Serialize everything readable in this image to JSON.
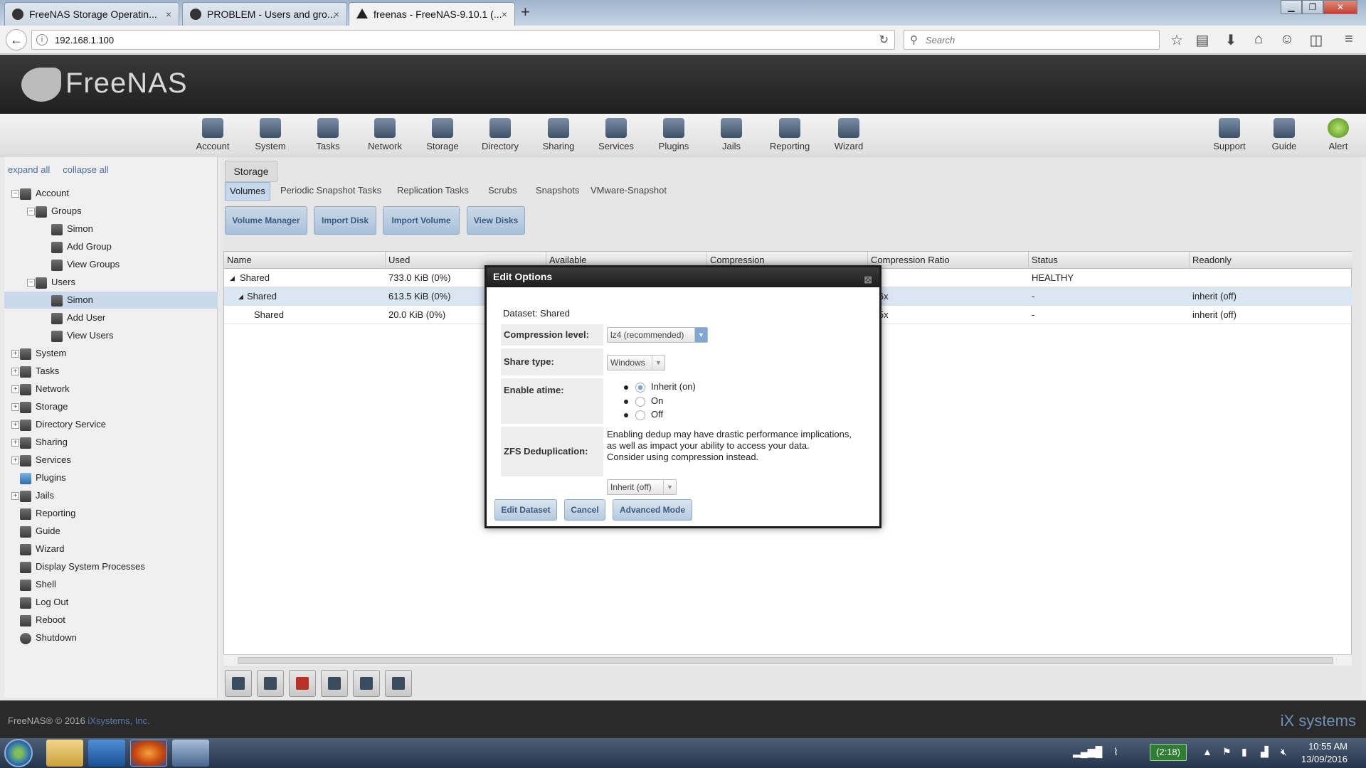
{
  "browser": {
    "tabs": [
      {
        "label": "FreeNAS Storage Operatin...",
        "close": "×"
      },
      {
        "label": "PROBLEM - Users and gro...",
        "close": "×"
      },
      {
        "label": "freenas - FreeNAS-9.10.1 (...",
        "close": "×"
      }
    ],
    "new_tab": "+",
    "url": "192.168.1.100",
    "search_placeholder": "Search"
  },
  "app": {
    "logo": "FreeNAS",
    "menu": [
      "Account",
      "System",
      "Tasks",
      "Network",
      "Storage",
      "Directory",
      "Sharing",
      "Services",
      "Plugins",
      "Jails",
      "Reporting",
      "Wizard"
    ],
    "menu_right": [
      "Support",
      "Guide",
      "Alert"
    ]
  },
  "sidebar": {
    "expand_all": "expand all",
    "collapse_all": "collapse all",
    "tree": [
      {
        "label": "Account",
        "toggle": "−"
      },
      {
        "label": "Groups",
        "toggle": "−"
      },
      {
        "label": "Simon"
      },
      {
        "label": "Add Group"
      },
      {
        "label": "View Groups"
      },
      {
        "label": "Users",
        "toggle": "−"
      },
      {
        "label": "Simon"
      },
      {
        "label": "Add User"
      },
      {
        "label": "View Users"
      },
      {
        "label": "System",
        "toggle": "+"
      },
      {
        "label": "Tasks",
        "toggle": "+"
      },
      {
        "label": "Network",
        "toggle": "+"
      },
      {
        "label": "Storage",
        "toggle": "+"
      },
      {
        "label": "Directory Service",
        "toggle": "+"
      },
      {
        "label": "Sharing",
        "toggle": "+"
      },
      {
        "label": "Services",
        "toggle": "+"
      },
      {
        "label": "Plugins"
      },
      {
        "label": "Jails",
        "toggle": "+"
      },
      {
        "label": "Reporting"
      },
      {
        "label": "Guide"
      },
      {
        "label": "Wizard"
      },
      {
        "label": "Display System Processes"
      },
      {
        "label": "Shell"
      },
      {
        "label": "Log Out"
      },
      {
        "label": "Reboot"
      },
      {
        "label": "Shutdown"
      }
    ]
  },
  "main": {
    "section_tab": "Storage",
    "subtabs": [
      "Volumes",
      "Periodic Snapshot Tasks",
      "Replication Tasks",
      "Scrubs",
      "Snapshots",
      "VMware-Snapshot"
    ],
    "buttons": [
      "Volume Manager",
      "Import Disk",
      "Import Volume",
      "View Disks"
    ],
    "columns": [
      "Name",
      "Used",
      "Available",
      "Compression",
      "Compression Ratio",
      "Status",
      "Readonly"
    ],
    "rows": [
      {
        "name": "Shared",
        "expander": "◢",
        "used": "733.0 KiB (0%)",
        "ratio": "",
        "status": "HEALTHY",
        "readonly": ""
      },
      {
        "name": "Shared",
        "expander": "◢",
        "used": "613.5 KiB (0%)",
        "ratio": ".16x",
        "status": "-",
        "readonly": "inherit (off)"
      },
      {
        "name": "Shared",
        "expander": "",
        "used": "20.0 KiB (0%)",
        "ratio": ".05x",
        "status": "-",
        "readonly": "inherit (off)"
      }
    ]
  },
  "modal": {
    "title": "Edit Options",
    "close": "⊠",
    "dataset_line": "Dataset: Shared",
    "compression_label": "Compression level:",
    "compression_value": "lz4 (recommended)",
    "share_type_label": "Share type:",
    "share_type_value": "Windows",
    "atime_label": "Enable atime:",
    "atime_options": [
      "Inherit (on)",
      "On",
      "Off"
    ],
    "atime_selected": 0,
    "dedup_label": "ZFS Deduplication:",
    "dedup_note": [
      "Enabling dedup may have drastic performance implications,",
      "as well as impact your ability to access your data.",
      "Consider using compression instead."
    ],
    "dedup_value": "Inherit (off)",
    "buttons": {
      "edit": "Edit Dataset",
      "cancel": "Cancel",
      "advanced": "Advanced Mode"
    }
  },
  "footer": {
    "copyright": "FreeNAS® © 2016",
    "company": "iXsystems, Inc.",
    "ix_logo": "iX systems"
  },
  "taskbar": {
    "battery": "(2:18)",
    "time": "10:55 AM",
    "date": "13/09/2016"
  }
}
